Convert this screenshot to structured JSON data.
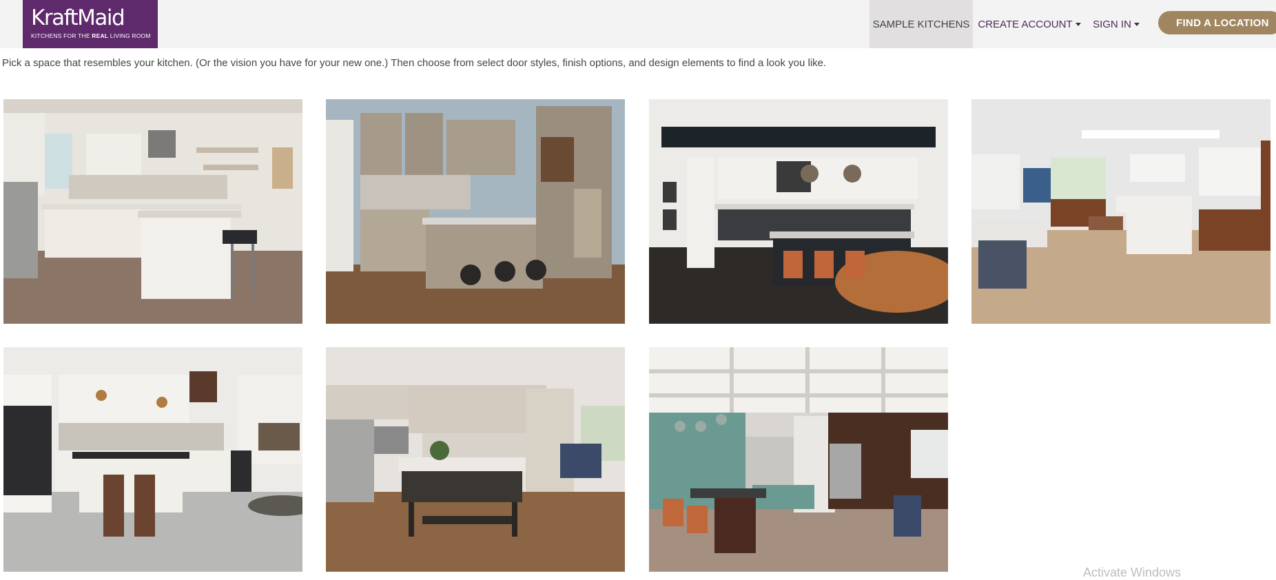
{
  "brand": {
    "name": "KraftMaid",
    "tagline_pre": "KITCHENS FOR THE ",
    "tagline_bold": "REAL",
    "tagline_post": " LIVING ROOM",
    "color": "#5e2a6b"
  },
  "nav": {
    "sample_kitchens": "SAMPLE KITCHENS",
    "create_account": "CREATE ACCOUNT",
    "sign_in": "SIGN IN",
    "find_location": "FIND A LOCATION",
    "accent_color": "#a08660"
  },
  "intro": "Pick a space that resembles your kitchen. (Or the vision you have for your new one.) Then choose from select door styles, finish options, and design elements to find a look you like.",
  "kitchens": [
    {
      "icon": "kitchen-photo-white-cabinets-island"
    },
    {
      "icon": "kitchen-photo-taupe-cabinets-peninsula"
    },
    {
      "icon": "kitchen-photo-black-island-dining-table"
    },
    {
      "icon": "kitchen-photo-open-plan-wood-lowers"
    },
    {
      "icon": "kitchen-photo-white-cabinets-black-fridge"
    },
    {
      "icon": "kitchen-photo-dark-island-stainless"
    },
    {
      "icon": "kitchen-photo-sage-cabinets-coffered-ceiling"
    }
  ],
  "watermark": "Activate Windows"
}
